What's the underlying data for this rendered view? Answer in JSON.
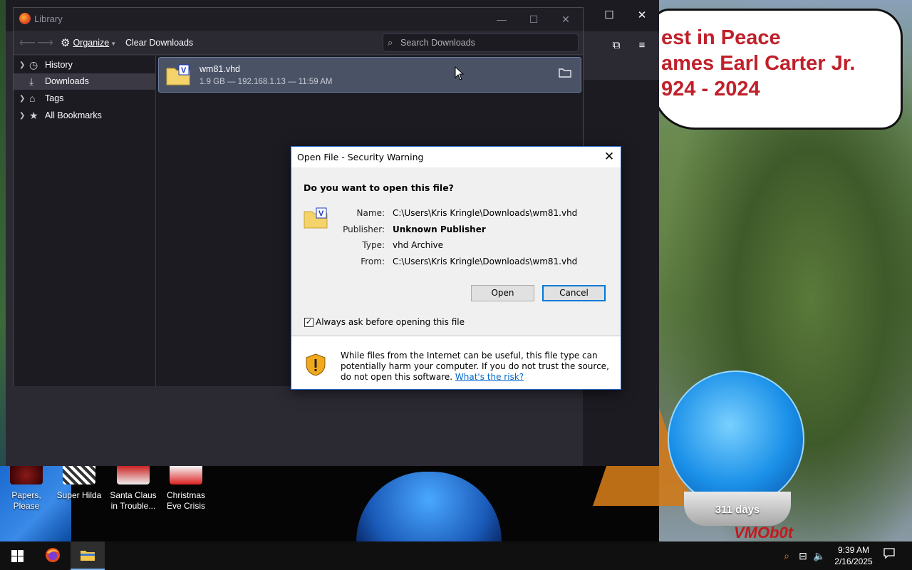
{
  "wallpaper": {
    "banner_lines": [
      "est in Peace",
      "ames Earl Carter Jr.",
      "924 - 2024"
    ],
    "countdown": "311 days",
    "signature": "VMOb0t"
  },
  "desktop_icons": [
    {
      "label_1": "Papers,",
      "label_2": "Please"
    },
    {
      "label_1": "Super Hilda",
      "label_2": ""
    },
    {
      "label_1": "Santa Claus",
      "label_2": "in Trouble..."
    },
    {
      "label_1": "Christmas",
      "label_2": "Eve Crisis"
    }
  ],
  "library": {
    "title": "Library",
    "toolbar": {
      "organize_label": "Organize",
      "clear_label": "Clear Downloads",
      "search_placeholder": "Search Downloads"
    },
    "sidebar": [
      {
        "label": "History",
        "icon": "clock-icon",
        "selected": false
      },
      {
        "label": "Downloads",
        "icon": "download-icon",
        "selected": true
      },
      {
        "label": "Tags",
        "icon": "tag-icon",
        "selected": false
      },
      {
        "label": "All Bookmarks",
        "icon": "star-icon",
        "selected": false
      }
    ],
    "downloads": [
      {
        "name": "wm81.vhd",
        "meta": "1.9 GB — 192.168.1.13 — 11:59 AM"
      }
    ]
  },
  "dialog": {
    "title": "Open File - Security Warning",
    "question": "Do you want to open this file?",
    "fields": {
      "name_label": "Name:",
      "name_value": "C:\\Users\\Kris Kringle\\Downloads\\wm81.vhd",
      "publisher_label": "Publisher:",
      "publisher_value": "Unknown Publisher",
      "type_label": "Type:",
      "type_value": "vhd Archive",
      "from_label": "From:",
      "from_value": "C:\\Users\\Kris Kringle\\Downloads\\wm81.vhd"
    },
    "open_label": "Open",
    "cancel_label": "Cancel",
    "checkbox_label": "Always ask before opening this file",
    "checkbox_checked": true,
    "warning_text": "While files from the Internet can be useful, this file type can potentially harm your computer. If you do not trust the source, do not open this software.",
    "risk_link": "What's the risk?"
  },
  "taskbar": {
    "time": "9:39 AM",
    "date": "2/16/2025"
  },
  "colors": {
    "accent": "#0078d7",
    "firefox_dark": "#1c1b22",
    "selection": "#4a5366"
  }
}
